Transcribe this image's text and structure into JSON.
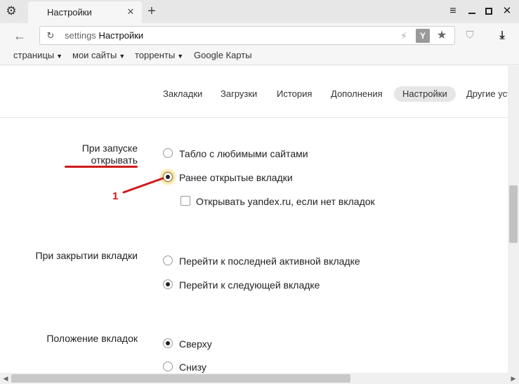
{
  "window": {
    "tab_title": "Настройки",
    "tab_close": "✕",
    "new_tab": "+",
    "menu_glyph": "≡",
    "close_glyph": "✕"
  },
  "toolbar": {
    "back_glyph": "←",
    "reload_glyph": "↻",
    "address_scheme": "settings",
    "address_title": "Настройки",
    "rocket_glyph": "⚡",
    "yandex_glyph": "Y",
    "star_glyph": "★",
    "shield_glyph": "⛉",
    "download_glyph": "⤓"
  },
  "bookmarks": [
    {
      "label": "страницы",
      "caret": "▼"
    },
    {
      "label": "мои сайты",
      "caret": "▼"
    },
    {
      "label": "торренты",
      "caret": "▼"
    },
    {
      "label": "Google Карты",
      "caret": ""
    }
  ],
  "settings_nav": {
    "tabs": [
      {
        "label": "Закладки"
      },
      {
        "label": "Загрузки"
      },
      {
        "label": "История"
      },
      {
        "label": "Дополнения"
      },
      {
        "label": "Настройки",
        "active": true
      },
      {
        "label": "Другие устро"
      }
    ]
  },
  "sections": {
    "startup": {
      "label_line1": "При запуске",
      "label_line2": "открывать",
      "option1": "Табло с любимыми сайтами",
      "option2": "Ранее открытые вкладки",
      "checkbox": "Открывать yandex.ru, если нет вкладок",
      "selected": 2,
      "checkbox_checked": false
    },
    "close_tab": {
      "label": "При закрытии вкладки",
      "option1": "Перейти к последней активной вкладке",
      "option2": "Перейти к следующей вкладке",
      "selected": 2
    },
    "tab_position": {
      "label": "Положение вкладок",
      "option1": "Сверху",
      "option2": "Снизу",
      "selected": 1
    }
  },
  "annotation": {
    "number": "1",
    "color": "#d11a1a"
  },
  "scrollbar": {
    "left_arrow": "◀",
    "right_arrow": "▶"
  }
}
